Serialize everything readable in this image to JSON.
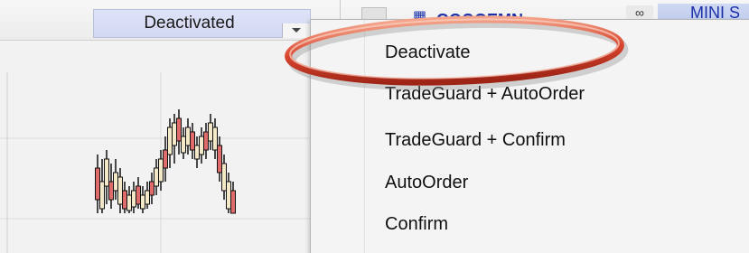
{
  "toolbar": {
    "status_value": "Deactivated",
    "instrument_tab_label": "GOOGEMN",
    "second_tab_label": "MINI S",
    "grid_icon": "grid-icon",
    "link_icon": "link-icon"
  },
  "menu": {
    "items": [
      {
        "label": "Deactivate"
      },
      {
        "label": "TradeGuard + AutoOrder"
      },
      {
        "label": "TradeGuard + Confirm"
      },
      {
        "label": "AutoOrder"
      },
      {
        "label": "Confirm"
      }
    ]
  },
  "highlight": {
    "color": "#c0392b",
    "target": "Deactivate"
  },
  "colors": {
    "status_button_bg": "#d8dcf5",
    "tab_text": "#1b2fa8",
    "candle_up": "#f3e8c8",
    "candle_down": "#e06b6b"
  }
}
